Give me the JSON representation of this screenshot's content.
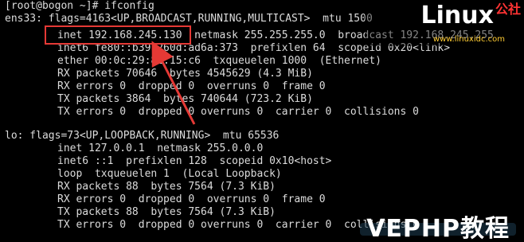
{
  "terminal": {
    "lines": [
      "[root@bogon ~]# ifconfig",
      "ens33: flags=4163<UP,BROADCAST,RUNNING,MULTICAST>  mtu 1500",
      "inet 192.168.245.130  netmask 255.255.255.0  broadcast 192.168.245.255",
      "inet6 fe80::b39:260d:ad6a:373  prefixlen 64  scopeid 0x20<link>",
      "ether 00:0c:29:82:15:c6  txqueuelen 1000  (Ethernet)",
      "RX packets 70646  bytes 4545629 (4.3 MiB)",
      "RX errors 0  dropped 0  overruns 0  frame 0",
      "TX packets 3864  bytes 740644 (723.2 KiB)",
      "TX errors 0  dropped 0 overruns 0  carrier 0  collisions 0",
      "",
      "lo: flags=73<UP,LOOPBACK,RUNNING>  mtu 65536",
      "inet 127.0.0.1  netmask 255.0.0.0",
      "inet6 ::1  prefixlen 128  scopeid 0x10<host>",
      "loop  txqueuelen 1  (Local Loopback)",
      "RX packets 88  bytes 7564 (7.3 KiB)",
      "RX errors 0  dropped 0  overruns 0  frame 0",
      "TX packets 88  bytes 7564 (7.3 KiB)",
      "TX errors 0  dropped 0 overruns 0  carrier 0  collisions 0"
    ]
  },
  "logo": {
    "brand": "Linux",
    "suffix": "公社",
    "url": "www.linuxidc.com"
  },
  "watermark": {
    "text": "VEPHP教程"
  },
  "colors": {
    "terminal_bg": "#000000",
    "terminal_fg": "#dcdcdc",
    "highlight": "#e53935"
  }
}
